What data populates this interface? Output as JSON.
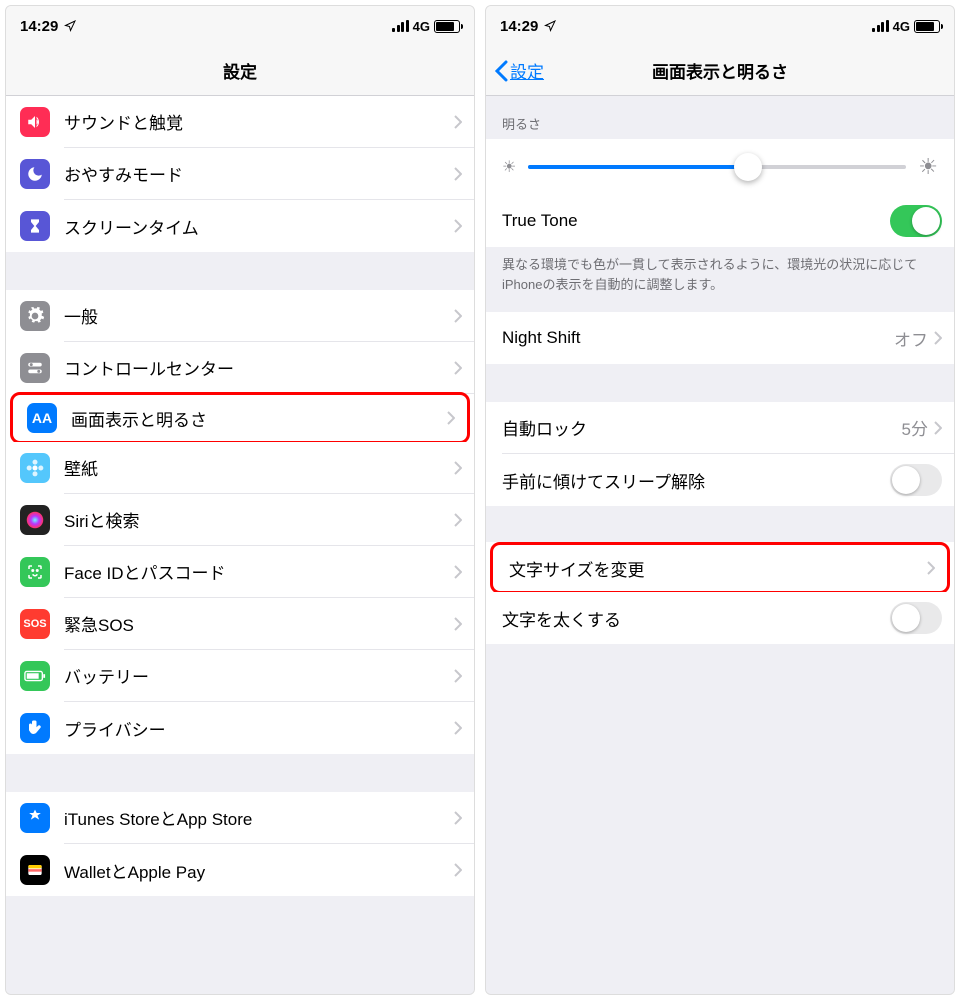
{
  "status": {
    "time": "14:29",
    "network": "4G"
  },
  "left": {
    "title": "設定",
    "sections": [
      {
        "rows": [
          {
            "id": "sounds",
            "label": "サウンドと触覚",
            "iconBg": "#ff2d55",
            "iconType": "speaker"
          },
          {
            "id": "dnd",
            "label": "おやすみモード",
            "iconBg": "#5856d6",
            "iconType": "moon"
          },
          {
            "id": "screentime",
            "label": "スクリーンタイム",
            "iconBg": "#5856d6",
            "iconType": "hourglass"
          }
        ]
      },
      {
        "rows": [
          {
            "id": "general",
            "label": "一般",
            "iconBg": "#8e8e93",
            "iconType": "gear"
          },
          {
            "id": "control-center",
            "label": "コントロールセンター",
            "iconBg": "#8e8e93",
            "iconType": "switches"
          },
          {
            "id": "display",
            "label": "画面表示と明るさ",
            "iconBg": "#007aff",
            "iconType": "text",
            "highlight": true
          },
          {
            "id": "wallpaper",
            "label": "壁紙",
            "iconBg": "#54c7fc",
            "iconType": "flower"
          },
          {
            "id": "siri",
            "label": "Siriと検索",
            "iconBg": "#222",
            "iconType": "siri"
          },
          {
            "id": "faceid",
            "label": "Face IDとパスコード",
            "iconBg": "#34c759",
            "iconType": "face"
          },
          {
            "id": "sos",
            "label": "緊急SOS",
            "iconBg": "#ff3b30",
            "iconType": "sos"
          },
          {
            "id": "battery",
            "label": "バッテリー",
            "iconBg": "#34c759",
            "iconType": "battery"
          },
          {
            "id": "privacy",
            "label": "プライバシー",
            "iconBg": "#007aff",
            "iconType": "hand"
          }
        ]
      },
      {
        "rows": [
          {
            "id": "appstore",
            "label": "iTunes StoreとApp Store",
            "iconBg": "#007aff",
            "iconType": "appstore"
          },
          {
            "id": "wallet",
            "label": "WalletとApple Pay",
            "iconBg": "#000",
            "iconType": "wallet"
          }
        ]
      }
    ]
  },
  "right": {
    "back": "設定",
    "title": "画面表示と明るさ",
    "brightnessHeader": "明るさ",
    "trueTone": {
      "label": "True Tone",
      "on": true
    },
    "trueToneFooter": "異なる環境でも色が一貫して表示されるように、環境光の状況に応じてiPhoneの表示を自動的に調整します。",
    "nightShift": {
      "label": "Night Shift",
      "value": "オフ"
    },
    "autoLock": {
      "label": "自動ロック",
      "value": "5分"
    },
    "raiseToWake": {
      "label": "手前に傾けてスリープ解除",
      "on": false
    },
    "textSize": {
      "label": "文字サイズを変更",
      "highlight": true
    },
    "boldText": {
      "label": "文字を太くする",
      "on": false
    }
  }
}
